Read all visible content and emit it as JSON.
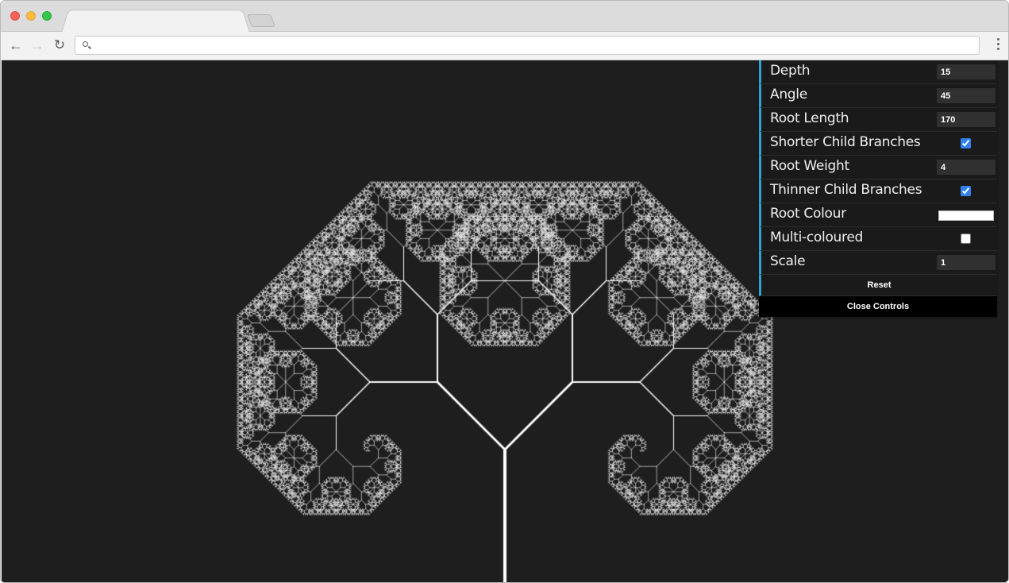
{
  "browser": {
    "address_value": "",
    "address_placeholder": ""
  },
  "controls": {
    "depth": {
      "label": "Depth",
      "value": "15"
    },
    "angle": {
      "label": "Angle",
      "value": "45"
    },
    "root_length": {
      "label": "Root Length",
      "value": "170"
    },
    "shorter_child_branches": {
      "label": "Shorter Child Branches",
      "checked": true
    },
    "root_weight": {
      "label": "Root Weight",
      "value": "4"
    },
    "thinner_child_branches": {
      "label": "Thinner Child Branches",
      "checked": true
    },
    "root_colour": {
      "label": "Root Colour",
      "value": "#ffffff"
    },
    "multi_coloured": {
      "label": "Multi-coloured",
      "checked": false
    },
    "scale": {
      "label": "Scale",
      "value": "1"
    },
    "reset_label": "Reset",
    "close_label": "Close Controls"
  },
  "colors": {
    "background": "#1e1e1e",
    "branch": "#ffffff",
    "gui_accent": "#2fa1d6"
  }
}
